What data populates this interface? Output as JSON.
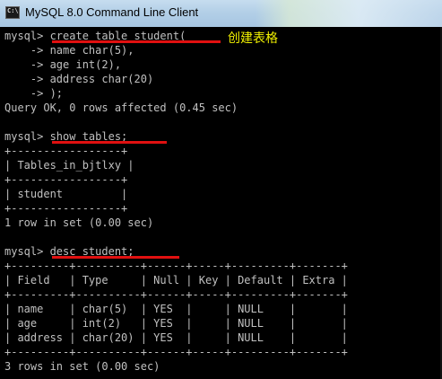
{
  "window": {
    "title": "MySQL 8.0 Command Line Client",
    "icon": "console-app-icon",
    "icon_glyph": "C:\\"
  },
  "annotation": "创建表格",
  "colors": {
    "console_bg": "#000000",
    "console_text": "#c0c0c0",
    "underline": "#e01010",
    "annotation": "#f0f000"
  },
  "console": {
    "lines": [
      "mysql> create table student(",
      "    -> name char(5),",
      "    -> age int(2),",
      "    -> address char(20)",
      "    -> );",
      "Query OK, 0 rows affected (0.45 sec)",
      "",
      "mysql> show tables;",
      "+-----------------+",
      "| Tables_in_bjtlxy |",
      "+-----------------+",
      "| student         |",
      "+-----------------+",
      "1 row in set (0.00 sec)",
      "",
      "mysql> desc student;",
      "+---------+----------+------+-----+---------+-------+",
      "| Field   | Type     | Null | Key | Default | Extra |",
      "+---------+----------+------+-----+---------+-------+",
      "| name    | char(5)  | YES  |     | NULL    |       |",
      "| age     | int(2)   | YES  |     | NULL    |       |",
      "| address | char(20) | YES  |     | NULL    |       |",
      "+---------+----------+------+-----+---------+-------+",
      "3 rows in set (0.00 sec)"
    ]
  }
}
